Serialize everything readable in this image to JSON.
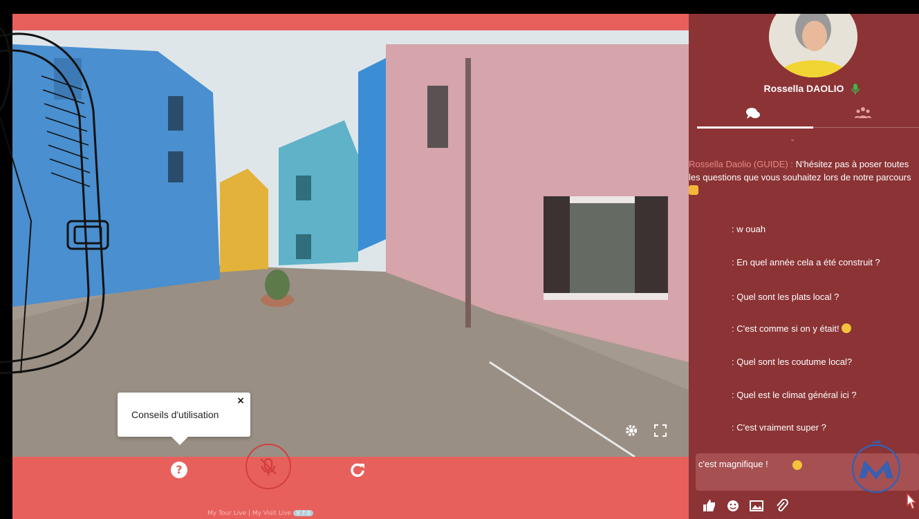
{
  "window": {
    "accent": "#e8605c",
    "sidebar_color": "#8b3335"
  },
  "tooltip": {
    "text": "Conseils d'utilisation",
    "close": "×"
  },
  "controls": {
    "help_symbol": "?",
    "icons": [
      "help-icon",
      "mic-muted-icon",
      "refresh-icon",
      "gear-icon",
      "fullscreen-icon"
    ]
  },
  "footer": {
    "text": "My Tour Live | My Visit Live",
    "version": "V 7.0"
  },
  "guide": {
    "name": "Rossella DAOLIO"
  },
  "tabs": [
    {
      "name": "chat",
      "icon": "chat-bubbles-icon",
      "active": true
    },
    {
      "name": "participants",
      "icon": "users-icon",
      "active": false
    }
  ],
  "chat": {
    "guide_message": {
      "author": "Rossella Daolio (GUIDE) :",
      "text": "N'hésitez pas à poser toutes les questions que vous souhaitez lors de notre parcours"
    },
    "messages": [
      ": w ouah",
      ": En quel année cela a été construit ?",
      ": Quel sont les plats local ?",
      ": C'est comme si on y était!",
      ": Quel sont les coutume local?",
      ": Quel est le climat général ici ?",
      ": C'est vraiment super ?"
    ]
  },
  "composer": {
    "value": "c'est magnifique !"
  }
}
